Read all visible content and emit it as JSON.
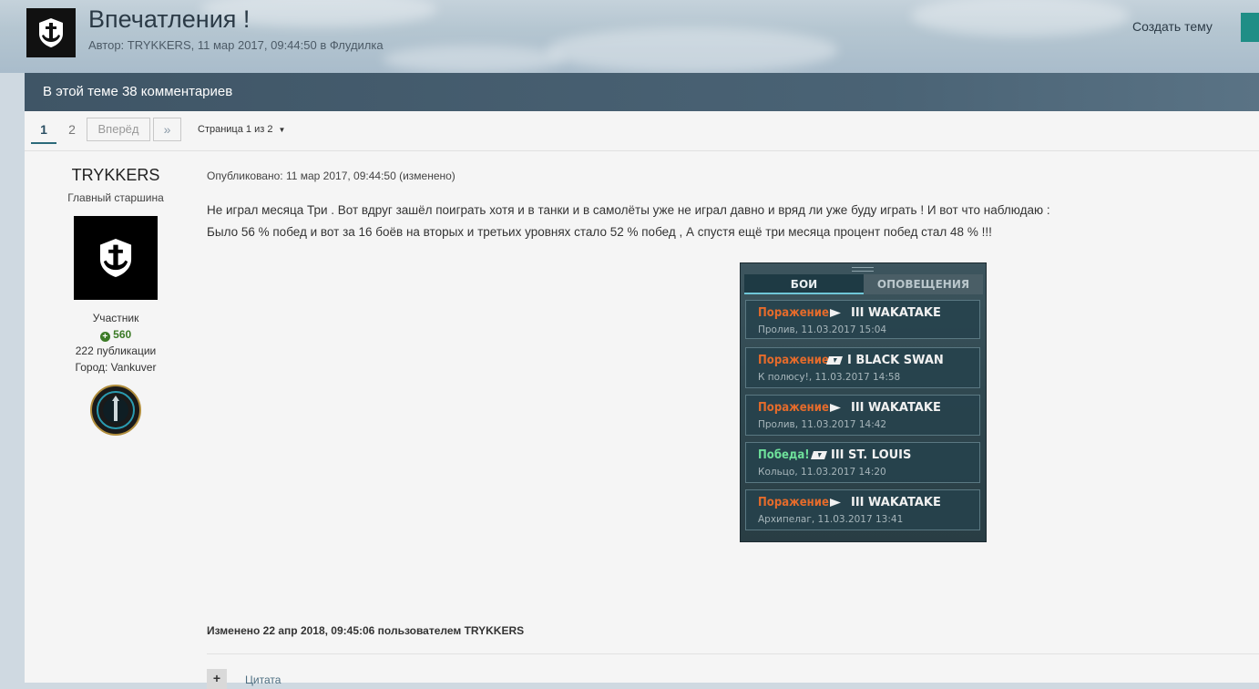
{
  "header": {
    "title": "Впечатления !",
    "meta": "Автор: TRYKKERS, 11 мар 2017, 09:44:50 в Флудилка",
    "create_topic": "Создать тему"
  },
  "comment_bar": {
    "text": "В этой теме 38 комментариев"
  },
  "pagination": {
    "page1": "1",
    "page2": "2",
    "next": "Вперёд",
    "last": "»",
    "page_of": "Страница 1 из 2"
  },
  "author": {
    "name": "TRYKKERS",
    "rank": "Главный старшина",
    "role": "Участник",
    "reputation": "560",
    "posts": "222 публикации",
    "city": "Город: Vankuver"
  },
  "post": {
    "published": "Опубликовано: 11 мар 2017, 09:44:50 (изменено)",
    "line1": "Не играл месяца Три . Вот вдруг зашёл поиграть хотя и в танки и в самолёты уже не играл давно и вряд ли уже буду играть ! И вот что наблюдаю :",
    "line2": "Было 56 % побед и вот за 16 боёв на вторых и третьих уровнях стало 52 % побед , А спустя ещё три месяца процент побед стал 48 % !!!",
    "edited": "Изменено 22 апр 2018, 09:45:06 пользователем TRYKKERS"
  },
  "game_screenshot": {
    "tab_battles": "БОИ",
    "tab_notifications": "ОПОВЕЩЕНИЯ",
    "rows": [
      {
        "result": "Поражение",
        "ship": "III WAKATAKE",
        "info": "Пролив, 11.03.2017 15:04"
      },
      {
        "result": "Поражение",
        "ship": "I BLACK SWAN",
        "info": "К полюсу!, 11.03.2017 14:58"
      },
      {
        "result": "Поражение",
        "ship": "III WAKATAKE",
        "info": "Пролив, 11.03.2017 14:42"
      },
      {
        "result": "Победа!",
        "ship": "III ST. LOUIS",
        "info": "Кольцо, 11.03.2017 14:20"
      },
      {
        "result": "Поражение",
        "ship": "III WAKATAKE",
        "info": "Архипелаг, 11.03.2017 13:41"
      }
    ]
  },
  "footer": {
    "plus": "+",
    "quote": "Цитата"
  },
  "colors": {
    "accent": "#1f8e86",
    "bar": "#455d6e",
    "loss": "#e56b2b",
    "win": "#6ee09a"
  }
}
